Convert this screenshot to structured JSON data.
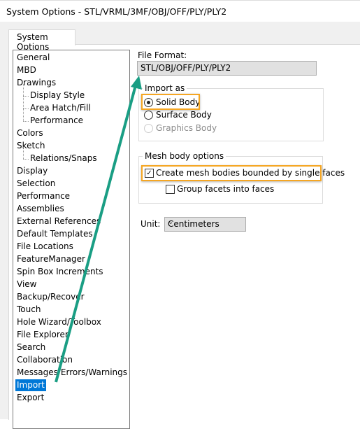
{
  "window": {
    "title": "System Options - STL/VRML/3MF/OBJ/OFF/PLY/PLY2"
  },
  "tab": {
    "label": "System Options"
  },
  "tree": {
    "items": [
      {
        "label": "General",
        "level": 0
      },
      {
        "label": "MBD",
        "level": 0
      },
      {
        "label": "Drawings",
        "level": 0
      },
      {
        "label": "Display Style",
        "level": 1
      },
      {
        "label": "Area Hatch/Fill",
        "level": 1
      },
      {
        "label": "Performance",
        "level": 1
      },
      {
        "label": "Colors",
        "level": 0
      },
      {
        "label": "Sketch",
        "level": 0
      },
      {
        "label": "Relations/Snaps",
        "level": 1
      },
      {
        "label": "Display",
        "level": 0
      },
      {
        "label": "Selection",
        "level": 0
      },
      {
        "label": "Performance",
        "level": 0
      },
      {
        "label": "Assemblies",
        "level": 0
      },
      {
        "label": "External References",
        "level": 0
      },
      {
        "label": "Default Templates",
        "level": 0
      },
      {
        "label": "File Locations",
        "level": 0
      },
      {
        "label": "FeatureManager",
        "level": 0
      },
      {
        "label": "Spin Box Increments",
        "level": 0
      },
      {
        "label": "View",
        "level": 0
      },
      {
        "label": "Backup/Recover",
        "level": 0
      },
      {
        "label": "Touch",
        "level": 0
      },
      {
        "label": "Hole Wizard/Toolbox",
        "level": 0
      },
      {
        "label": "File Explorer",
        "level": 0
      },
      {
        "label": "Search",
        "level": 0
      },
      {
        "label": "Collaboration",
        "level": 0
      },
      {
        "label": "Messages/Errors/Warnings",
        "level": 0
      },
      {
        "label": "Import",
        "level": 0,
        "selected": true
      },
      {
        "label": "Export",
        "level": 0
      }
    ]
  },
  "file_format": {
    "label": "File Format:",
    "value": "STL/OBJ/OFF/PLY/PLY2"
  },
  "import_as": {
    "label": "Import as",
    "options": [
      {
        "label": "Solid Body",
        "checked": true,
        "enabled": true
      },
      {
        "label": "Surface Body",
        "checked": false,
        "enabled": true
      },
      {
        "label": "Graphics Body",
        "checked": false,
        "enabled": false
      }
    ]
  },
  "mesh": {
    "label": "Mesh body options",
    "create_label": "Create mesh bodies bounded by single faces",
    "create_checked": true,
    "group_label": "Group facets into faces",
    "group_checked": false
  },
  "unit": {
    "label": "Unit:",
    "value": "Centimeters"
  },
  "colors": {
    "highlight": "#f5a623",
    "arrow": "#1a9e84",
    "selection": "#0078d7"
  }
}
